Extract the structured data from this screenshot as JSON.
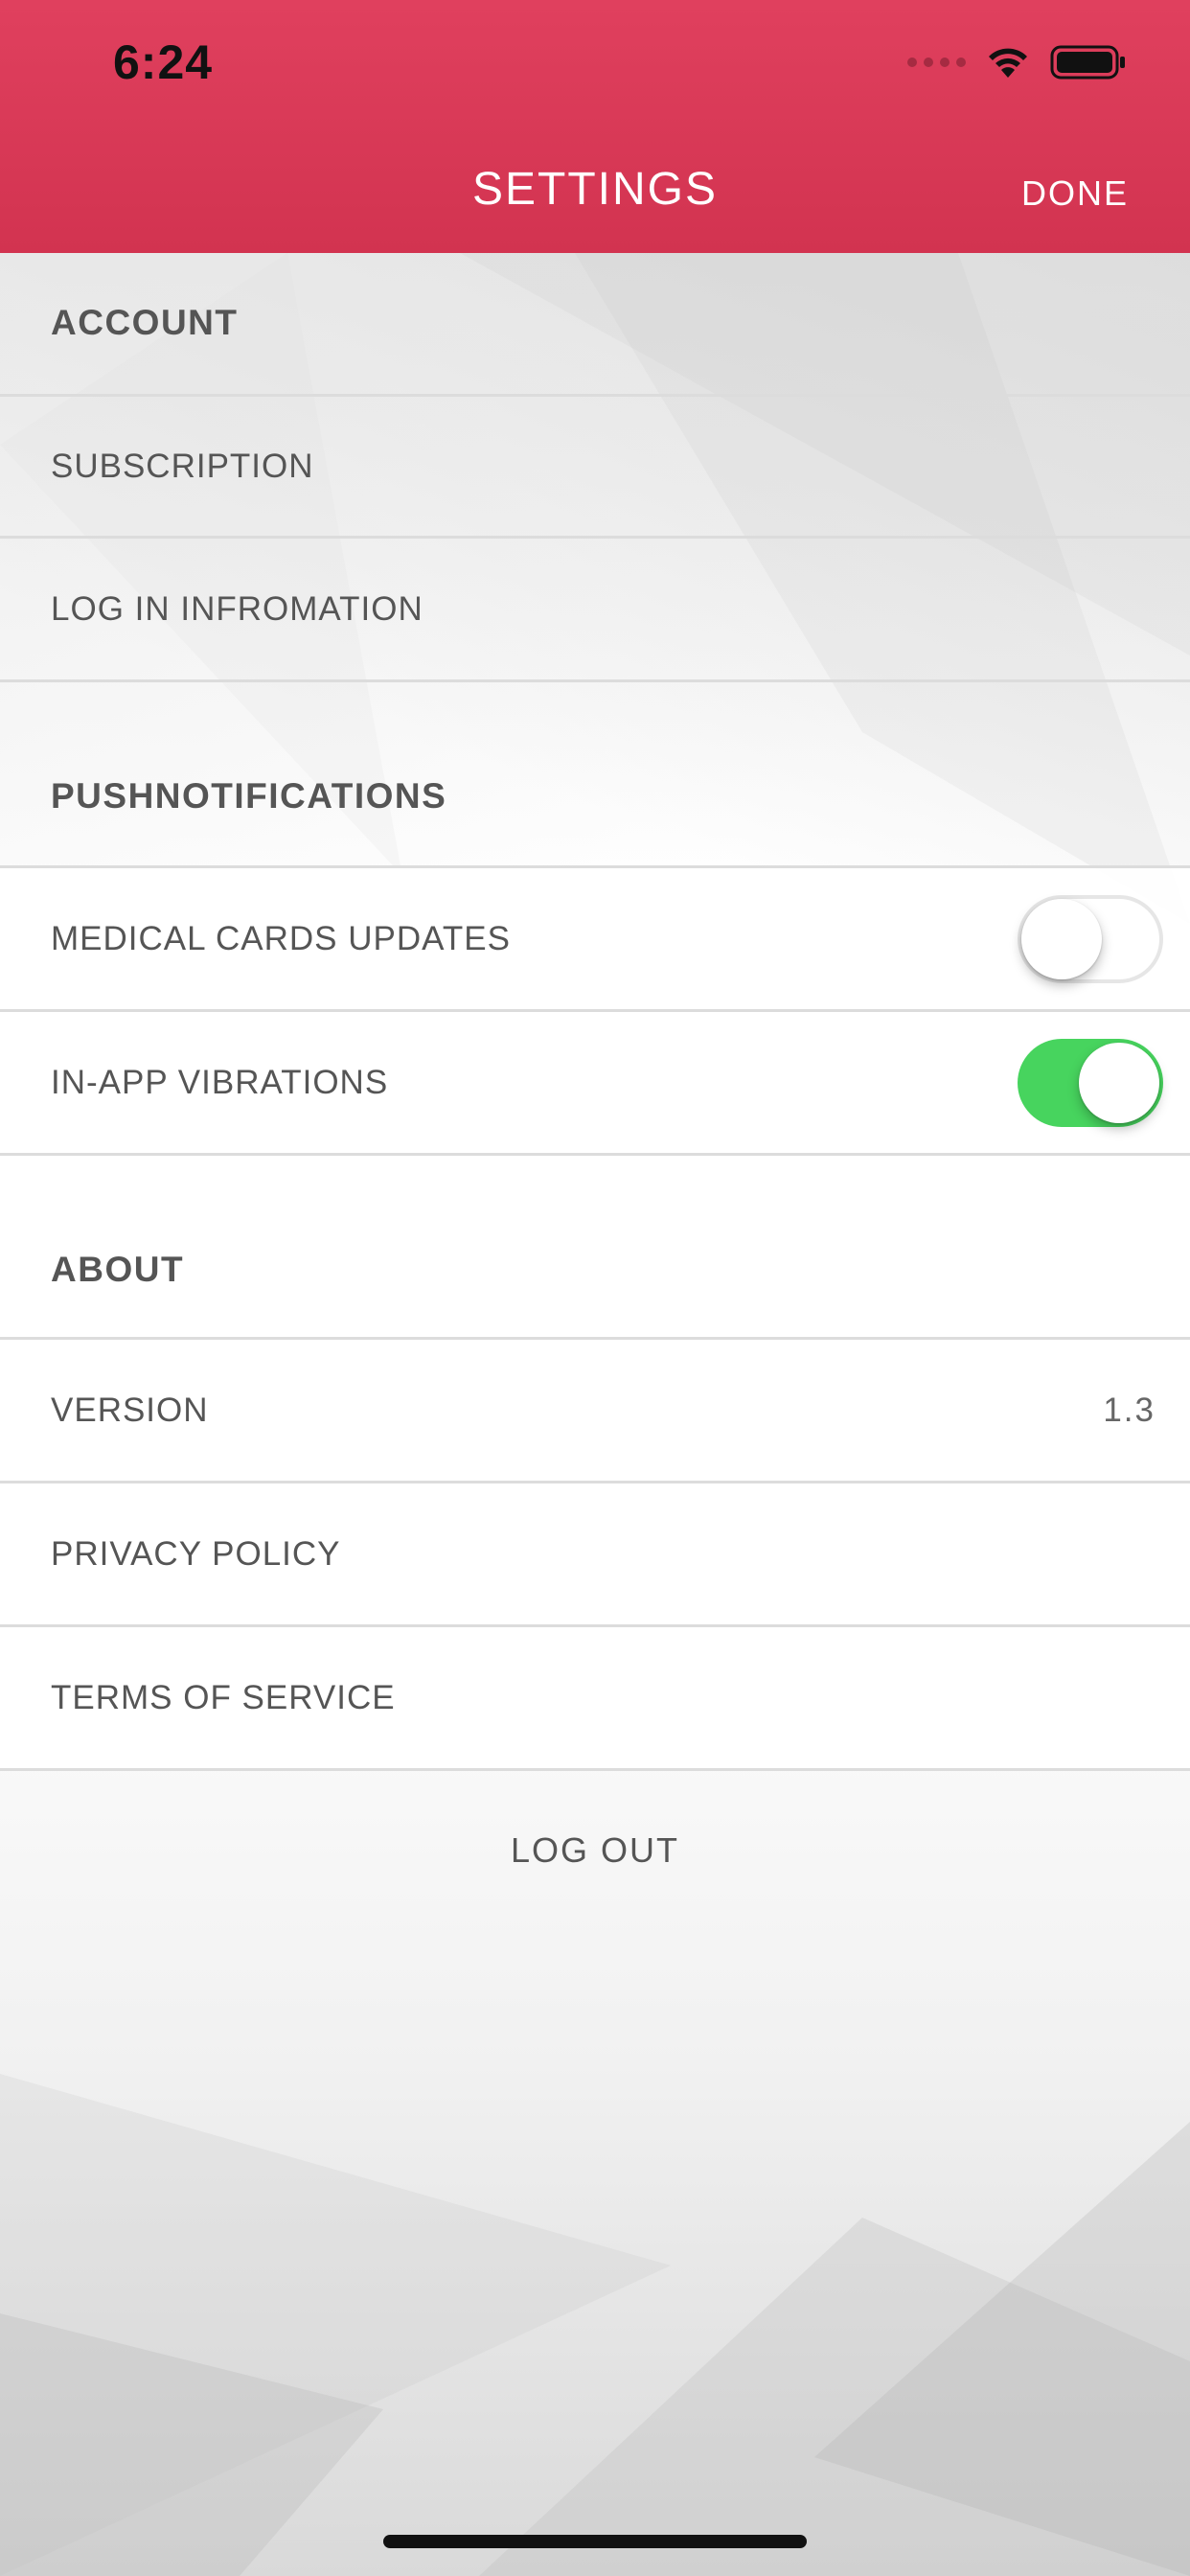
{
  "status_bar": {
    "time": "6:24"
  },
  "header": {
    "title": "SETTINGS",
    "done_label": "DONE"
  },
  "sections": {
    "account": {
      "title": "ACCOUNT",
      "items": [
        "SUBSCRIPTION",
        "LOG IN INFROMATION"
      ]
    },
    "push": {
      "title": "PUSHNOTIFICATIONS",
      "items": [
        {
          "label": "MEDICAL CARDS UPDATES",
          "enabled": false
        },
        {
          "label": "IN-APP VIBRATIONS",
          "enabled": true
        }
      ]
    },
    "about": {
      "title": "ABOUT",
      "version_label": "VERSION",
      "version_value": "1.3",
      "items": [
        "PRIVACY POLICY",
        "TERMS OF SERVICE"
      ]
    }
  },
  "logout_label": "LOG OUT",
  "colors": {
    "header": "#d8384f",
    "toggle_on": "#47d45e"
  }
}
